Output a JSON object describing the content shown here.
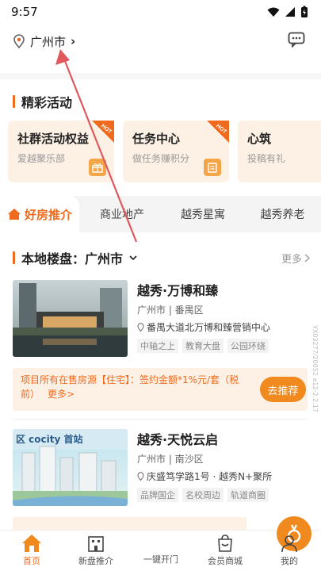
{
  "status_bar": {
    "time": "9:57"
  },
  "header": {
    "city": "广州市",
    "chevron": "›"
  },
  "activities": {
    "title": "精彩活动",
    "items": [
      {
        "name": "社群活动权益",
        "sub": "爱越聚乐部",
        "hot": "HOT",
        "icon": "gift-icon"
      },
      {
        "name": "任务中心",
        "sub": "做任务赚积分",
        "hot": "HOT",
        "icon": "clipboard-icon"
      },
      {
        "name": "心筑",
        "sub": "投稿有礼"
      }
    ]
  },
  "tabs": [
    {
      "label": "好房推介",
      "active": true
    },
    {
      "label": "商业地产"
    },
    {
      "label": "越秀星寓"
    },
    {
      "label": "越秀养老"
    }
  ],
  "local": {
    "title": "本地楼盘：广州市",
    "more": "更多"
  },
  "listings": [
    {
      "title": "越秀·万博和臻",
      "area": "广州市 | 番禺区",
      "address": "番禺大道北万博和臻营销中心",
      "tags": [
        "中轴之上",
        "教育大盘",
        "公园环绕"
      ],
      "promo": "项目所有在售房源【住宅】：签约金额*1%元/套（税前）",
      "promo_more": "更多>",
      "promo_button": "去推荐"
    },
    {
      "title": "越秀·天悦云启",
      "area": "广州市 | 南沙区",
      "address": "庆盛笃学路1号 · 越秀N+聚所",
      "tags": [
        "品牌国企",
        "名校周边",
        "轨道商圈"
      ],
      "photo_text": "区 cocity 首站"
    }
  ],
  "bottom_nav": [
    {
      "label": "首页",
      "icon": "home-icon",
      "active": true
    },
    {
      "label": "新盘推介",
      "icon": "building-icon"
    },
    {
      "label": "一键开门",
      "icon": "key-icon"
    },
    {
      "label": "会员商城",
      "icon": "shopping-bag-icon"
    },
    {
      "label": "我的",
      "icon": "user-icon"
    }
  ],
  "side_id": "YX03277/20052 a12-2.2.17",
  "colors": {
    "accent": "#f06a1d",
    "card_bg": "#fdf1e6",
    "arrow": "#e0585b"
  }
}
